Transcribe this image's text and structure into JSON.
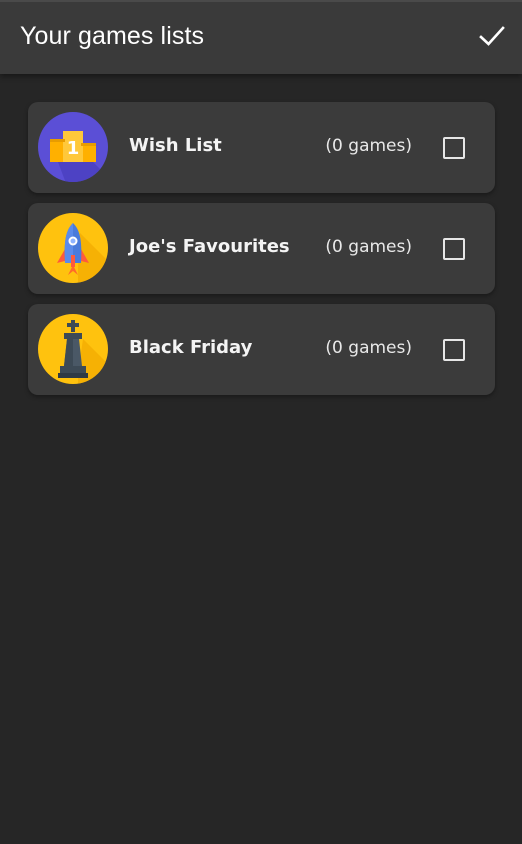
{
  "header": {
    "title": "Your games lists",
    "confirm_icon": "checkmark-icon"
  },
  "lists": [
    {
      "name": "Wish List",
      "count": "(0 games)",
      "icon": "podium-icon",
      "icon_bg": "#5b4fd6",
      "checked": false
    },
    {
      "name": "Joe's Favourites",
      "count": "(0 games)",
      "icon": "rocket-icon",
      "icon_bg": "#ffc20e",
      "checked": false
    },
    {
      "name": "Black Friday",
      "count": "(0 games)",
      "icon": "chess-king-icon",
      "icon_bg": "#ffc20e",
      "checked": false
    }
  ],
  "colors": {
    "background": "#262626",
    "appbar": "#3a3a3a",
    "card": "#3b3b3b",
    "text": "#ffffff"
  }
}
